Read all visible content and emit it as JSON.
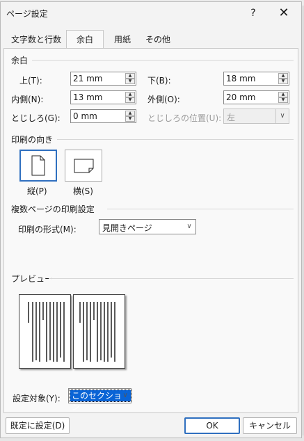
{
  "dialog": {
    "title": "ページ設定",
    "help_glyph": "?",
    "close_glyph": "✕"
  },
  "tabs": [
    {
      "label": "文字数と行数"
    },
    {
      "label": "余白",
      "active": true
    },
    {
      "label": "用紙"
    },
    {
      "label": "その他"
    }
  ],
  "margins": {
    "section_label": "余白",
    "top": {
      "label": "上(T):",
      "value": "21 mm"
    },
    "bottom": {
      "label": "下(B):",
      "value": "18 mm"
    },
    "inside": {
      "label": "内側(N):",
      "value": "13 mm"
    },
    "outside": {
      "label": "外側(O):",
      "value": "20 mm"
    },
    "gutter": {
      "label": "とじしろ(G):",
      "value": "0 mm"
    },
    "gutter_position": {
      "label": "とじしろの位置(U):",
      "value": "左",
      "disabled": true
    }
  },
  "orientation": {
    "section_label": "印刷の向き",
    "portrait": {
      "label": "縦(P)",
      "selected": true
    },
    "landscape": {
      "label": "横(S)",
      "selected": false
    }
  },
  "pages": {
    "section_label": "複数ページの印刷設定",
    "format_label": "印刷の形式(M):",
    "format_value": "見開きページ"
  },
  "preview": {
    "section_label": "プレビュー"
  },
  "apply": {
    "label": "設定対象(Y):",
    "value": "このセクション"
  },
  "buttons": {
    "default": "既定に設定(D)",
    "ok": "OK",
    "cancel": "キャンセル"
  },
  "arrows": {
    "spin_up": "▲",
    "spin_down": "▼",
    "dropdown": "∨"
  }
}
